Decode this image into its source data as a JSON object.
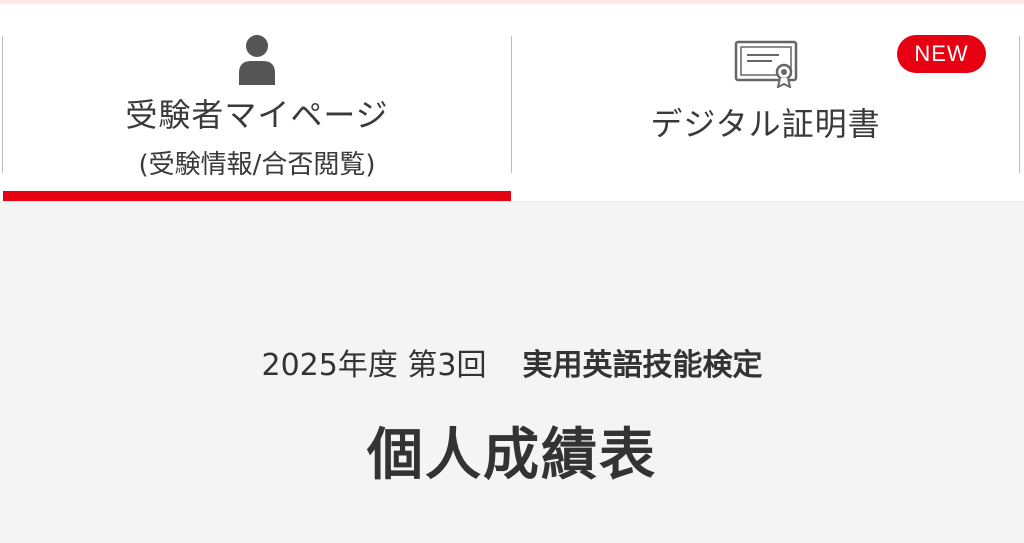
{
  "tabs": {
    "mypage": {
      "label": "受験者マイページ",
      "sublabel": "(受験情報/合否閲覧)",
      "icon": "person-icon",
      "active": true
    },
    "certificate": {
      "label": "デジタル証明書",
      "icon": "certificate-icon",
      "badge": "NEW"
    }
  },
  "exam": {
    "session": "2025年度 第3回",
    "name": "実用英語技能検定"
  },
  "page": {
    "title": "個人成績表"
  },
  "colors": {
    "accent": "#e60012",
    "background": "#f4f4f4",
    "text": "#333333"
  }
}
